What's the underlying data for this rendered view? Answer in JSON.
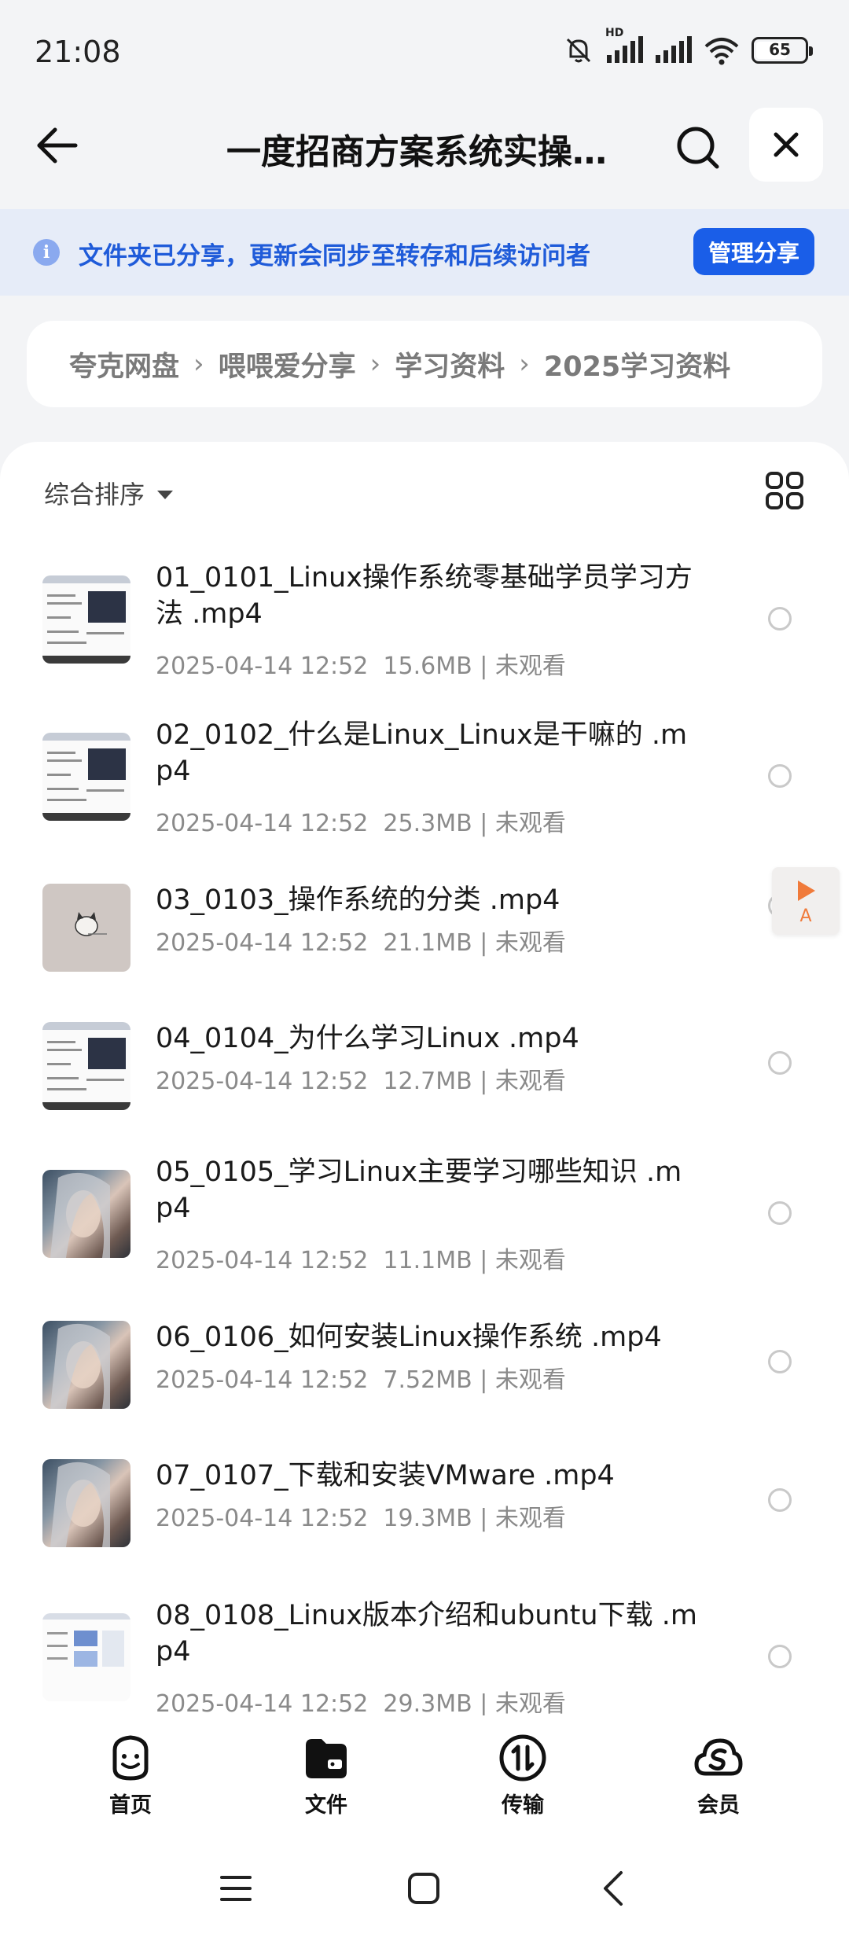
{
  "status_bar": {
    "time": "21:08",
    "network_label": "HD",
    "battery": "65",
    "battery_level": 0.65
  },
  "header": {
    "title": "一度招商方案系统实操…",
    "back_icon": "arrow-left-icon",
    "search_icon": "search-icon",
    "close_icon": "close-icon"
  },
  "share_banner": {
    "text": "文件夹已分享，更新会同步至转存和后续访问者",
    "button": "管理分享",
    "icon": "info-icon",
    "accent_color": "#1a5ee8"
  },
  "breadcrumb": [
    "夸克网盘",
    "喂喂爱分享",
    "学习资料",
    "2025学习资料"
  ],
  "list": {
    "sort_label": "综合排序",
    "view_toggle_icon": "grid-view-icon",
    "files": [
      {
        "name": "01_0101_Linux操作系统零基础学员学习方法 .mp4",
        "date": "2025-04-14 12:52",
        "size": "15.6MB",
        "status": "未观看",
        "thumb": "doc"
      },
      {
        "name": "02_0102_什么是Linux_Linux是干嘛的 .mp4",
        "date": "2025-04-14 12:52",
        "size": "25.3MB",
        "status": "未观看",
        "thumb": "doc"
      },
      {
        "name": "03_0103_操作系统的分类 .mp4",
        "date": "2025-04-14 12:52",
        "size": "21.1MB",
        "status": "未观看",
        "thumb": "cat"
      },
      {
        "name": "04_0104_为什么学习Linux .mp4",
        "date": "2025-04-14 12:52",
        "size": "12.7MB",
        "status": "未观看",
        "thumb": "doc"
      },
      {
        "name": "05_0105_学习Linux主要学习哪些知识 .mp4",
        "date": "2025-04-14 12:52",
        "size": "11.1MB",
        "status": "未观看",
        "thumb": "girl"
      },
      {
        "name": "06_0106_如何安装Linux操作系统 .mp4",
        "date": "2025-04-14 12:52",
        "size": "7.52MB",
        "status": "未观看",
        "thumb": "girl"
      },
      {
        "name": "07_0107_下载和安装VMware .mp4",
        "date": "2025-04-14 12:52",
        "size": "19.3MB",
        "status": "未观看",
        "thumb": "girl"
      },
      {
        "name": "08_0108_Linux版本介绍和ubuntu下载 .mp4",
        "date": "2025-04-14 12:52",
        "size": "29.3MB",
        "status": "未观看",
        "thumb": "web"
      }
    ]
  },
  "float_widget": {
    "label": "A",
    "icon": "play-icon"
  },
  "bottom_nav": [
    {
      "label": "首页",
      "icon": "smiley-home-icon"
    },
    {
      "label": "文件",
      "icon": "folder-icon"
    },
    {
      "label": "传输",
      "icon": "transfer-icon"
    },
    {
      "label": "会员",
      "icon": "vip-cloud-icon"
    }
  ],
  "system_nav": [
    "menu-icon",
    "home-square-icon",
    "back-chevron-icon"
  ]
}
